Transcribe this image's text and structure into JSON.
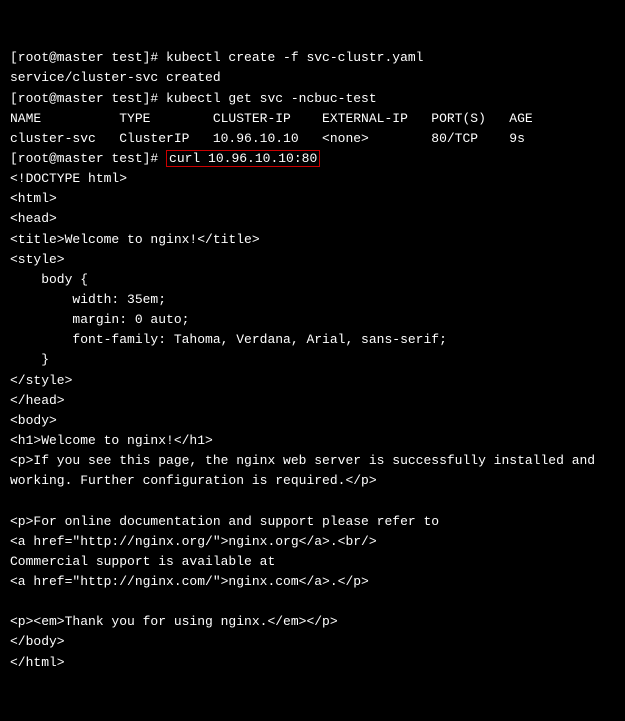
{
  "l1": "[root@master test]# kubectl create -f svc-clustr.yaml",
  "l2": "service/cluster-svc created",
  "l3": "[root@master test]# kubectl get svc -ncbuc-test",
  "l4": "NAME          TYPE        CLUSTER-IP    EXTERNAL-IP   PORT(S)   AGE",
  "l5": "cluster-svc   ClusterIP   10.96.10.10   <none>        80/TCP    9s",
  "l6a": "[root@master test]# ",
  "l6b": "curl 10.96.10.10:80",
  "l7": "<!DOCTYPE html>",
  "l8": "<html>",
  "l9": "<head>",
  "l10": "<title>Welcome to nginx!</title>",
  "l11": "<style>",
  "l12": "    body {",
  "l13": "        width: 35em;",
  "l14": "        margin: 0 auto;",
  "l15": "        font-family: Tahoma, Verdana, Arial, sans-serif;",
  "l16": "    }",
  "l17": "</style>",
  "l18": "</head>",
  "l19": "<body>",
  "l20": "<h1>Welcome to nginx!</h1>",
  "l21": "<p>If you see this page, the nginx web server is successfully installed and",
  "l22": "working. Further configuration is required.</p>",
  "l23": "",
  "l24": "<p>For online documentation and support please refer to",
  "l25": "<a href=\"http://nginx.org/\">nginx.org</a>.<br/>",
  "l26": "Commercial support is available at",
  "l27": "<a href=\"http://nginx.com/\">nginx.com</a>.</p>",
  "l28": "",
  "l29": "<p><em>Thank you for using nginx.</em></p>",
  "l30": "</body>",
  "l31": "</html>"
}
